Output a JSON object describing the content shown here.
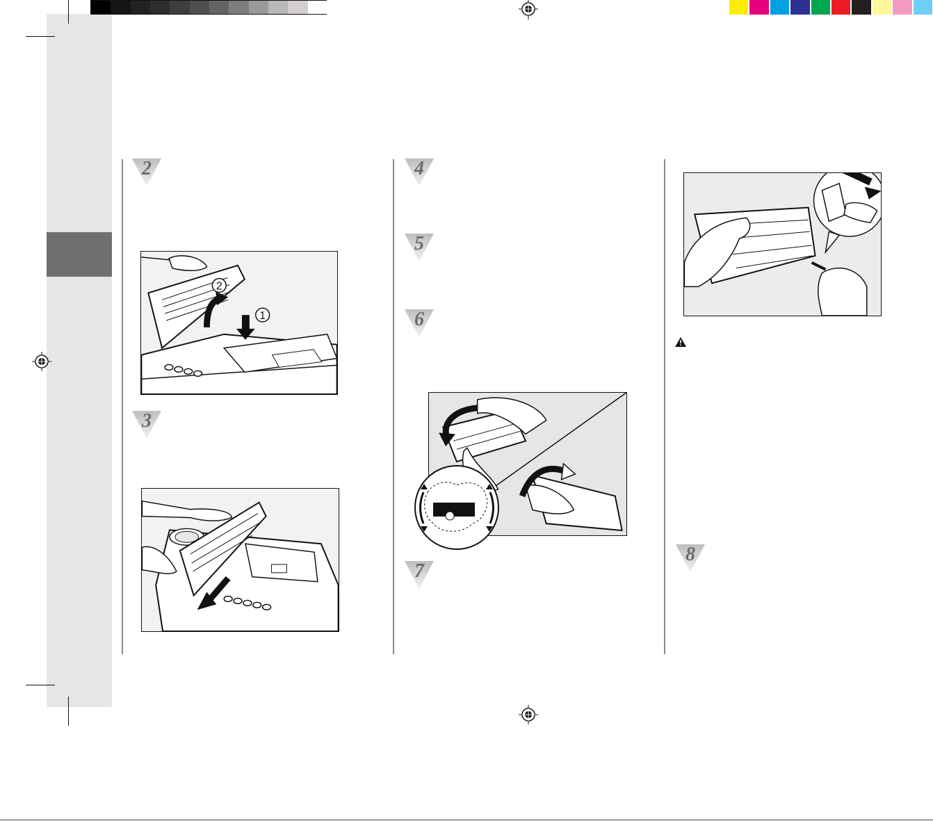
{
  "page": {
    "steps": [
      {
        "id": "step-2",
        "number": "2"
      },
      {
        "id": "step-3",
        "number": "3"
      },
      {
        "id": "step-4",
        "number": "4"
      },
      {
        "id": "step-5",
        "number": "5"
      },
      {
        "id": "step-6",
        "number": "6"
      },
      {
        "id": "step-7",
        "number": "7"
      },
      {
        "id": "step-8",
        "number": "8"
      }
    ],
    "figure_callouts": {
      "open_lid_step_one": "1",
      "open_lid_step_two": "2"
    }
  },
  "colors": {
    "sidebar": "#e6e6e6",
    "tab": "#6f6f6f",
    "gray_scale": [
      "#000000",
      "#141414",
      "#222222",
      "#2e2e2e",
      "#3d3d3d",
      "#4f4f4f",
      "#646464",
      "#7d7d7d",
      "#9a9a9a",
      "#b8b8b8",
      "#d5d0d0",
      "#ffffff"
    ],
    "color_bar": [
      "#ffed00",
      "#e6007e",
      "#00a0e4",
      "#2e3192",
      "#00a651",
      "#ed1c24",
      "#231f20",
      "#fff799",
      "#f49ac1",
      "#6dcff6"
    ]
  },
  "icons": [
    "registration-mark-icon",
    "warning-icon",
    "curved-arrow-icon",
    "down-arrow-icon"
  ]
}
